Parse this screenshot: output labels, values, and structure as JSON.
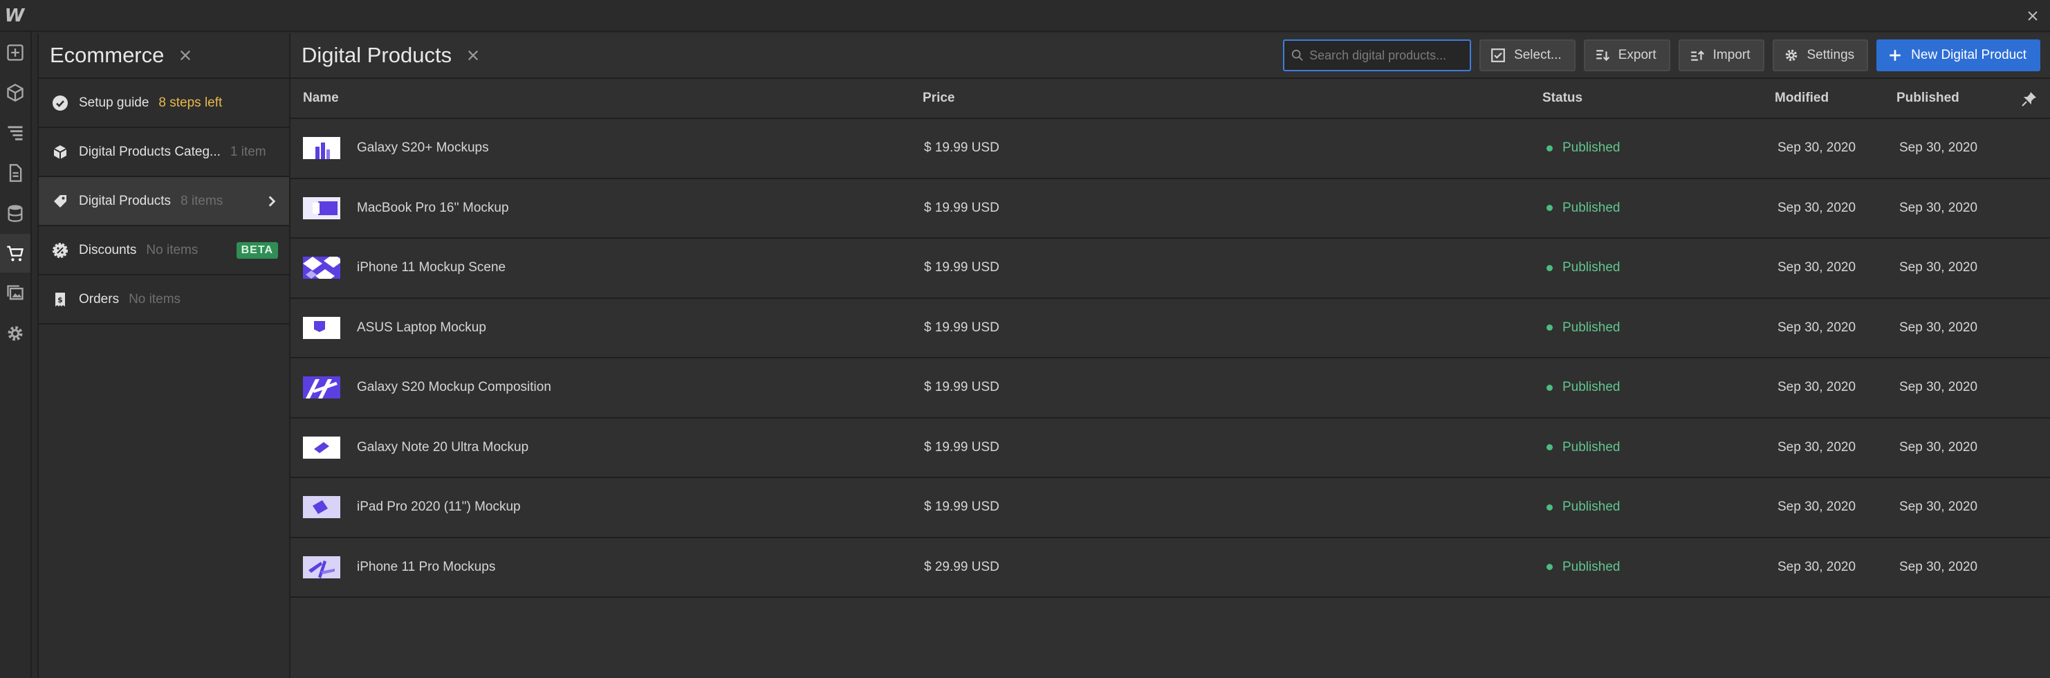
{
  "app": {
    "logo": "W"
  },
  "panel": {
    "title": "Ecommerce",
    "items": [
      {
        "label": "Setup guide",
        "extra": "8 steps left",
        "icon": "check-circle-icon"
      },
      {
        "label": "Digital Products Categ...",
        "count": "1 item",
        "icon": "box-icon"
      },
      {
        "label": "Digital Products",
        "count": "8 items",
        "icon": "tag-icon"
      },
      {
        "label": "Discounts",
        "count": "No items",
        "badge": "BETA",
        "icon": "badge-gear-icon"
      },
      {
        "label": "Orders",
        "count": "No items",
        "icon": "receipt-icon"
      }
    ]
  },
  "main": {
    "title": "Digital Products",
    "search_placeholder": "Search digital products...",
    "buttons": {
      "select": "Select...",
      "export": "Export",
      "import": "Import",
      "settings": "Settings",
      "new": "New Digital Product"
    },
    "columns": {
      "name": "Name",
      "price": "Price",
      "status": "Status",
      "modified": "Modified",
      "published": "Published"
    },
    "rows": [
      {
        "name": "Galaxy S20+ Mockups",
        "price": "$ 19.99 USD",
        "status": "Published",
        "modified": "Sep 30, 2020",
        "published": "Sep 30, 2020"
      },
      {
        "name": "MacBook Pro 16'' Mockup",
        "price": "$ 19.99 USD",
        "status": "Published",
        "modified": "Sep 30, 2020",
        "published": "Sep 30, 2020"
      },
      {
        "name": "iPhone 11 Mockup Scene",
        "price": "$ 19.99 USD",
        "status": "Published",
        "modified": "Sep 30, 2020",
        "published": "Sep 30, 2020"
      },
      {
        "name": "ASUS Laptop Mockup",
        "price": "$ 19.99 USD",
        "status": "Published",
        "modified": "Sep 30, 2020",
        "published": "Sep 30, 2020"
      },
      {
        "name": "Galaxy S20 Mockup Composition",
        "price": "$ 19.99 USD",
        "status": "Published",
        "modified": "Sep 30, 2020",
        "published": "Sep 30, 2020"
      },
      {
        "name": "Galaxy Note 20 Ultra Mockup",
        "price": "$ 19.99 USD",
        "status": "Published",
        "modified": "Sep 30, 2020",
        "published": "Sep 30, 2020"
      },
      {
        "name": "iPad Pro 2020 (11\") Mockup",
        "price": "$ 19.99 USD",
        "status": "Published",
        "modified": "Sep 30, 2020",
        "published": "Sep 30, 2020"
      },
      {
        "name": "iPhone 11 Pro Mockups",
        "price": "$ 29.99 USD",
        "status": "Published",
        "modified": "Sep 30, 2020",
        "published": "Sep 30, 2020"
      }
    ]
  },
  "colors": {
    "accent": "#2e6fd6",
    "status_published": "#62c58e",
    "warning": "#e9b84b",
    "beta": "#2f8d55",
    "thumb_purple": "#5b3fe0"
  }
}
